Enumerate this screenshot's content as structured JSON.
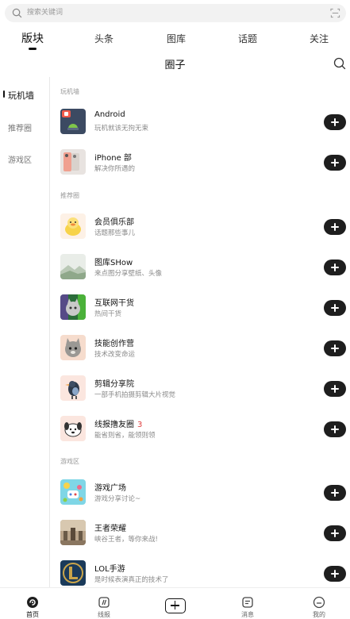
{
  "search": {
    "placeholder": "搜索关键词"
  },
  "tabs": [
    {
      "label": "版块",
      "active": true
    },
    {
      "label": "头条"
    },
    {
      "label": "图库"
    },
    {
      "label": "话题"
    },
    {
      "label": "关注"
    }
  ],
  "header": {
    "title": "圈子"
  },
  "sidebar": {
    "items": [
      {
        "label": "玩机墙",
        "active": true
      },
      {
        "label": "推荐圈"
      },
      {
        "label": "游戏区"
      }
    ]
  },
  "sections": [
    {
      "title": "玩机墙",
      "items": [
        {
          "name": "Android",
          "desc": "玩机就该无拘无束",
          "thumb": "android"
        },
        {
          "name": "iPhone 部",
          "desc": "解决你所遇的",
          "thumb": "iphone"
        }
      ]
    },
    {
      "title": "推荐圈",
      "items": [
        {
          "name": "会员俱乐部",
          "desc": "话题那些事儿",
          "thumb": "duck"
        },
        {
          "name": "图库SHow",
          "desc": "来点图分享壁纸、头像",
          "thumb": "landscape"
        },
        {
          "name": "互联网干货",
          "desc": "热间干货",
          "thumb": "cat-green"
        },
        {
          "name": "技能创作营",
          "desc": "技术改变命运",
          "thumb": "cat-grey"
        },
        {
          "name": "剪辑分享院",
          "desc": "一部手机拍摄剪辑大片视觉",
          "thumb": "bird"
        },
        {
          "name": "线报撸友圈",
          "desc": "能省则省，能领则领",
          "thumb": "dog",
          "badge": "3"
        }
      ]
    },
    {
      "title": "游戏区",
      "items": [
        {
          "name": "游戏广场",
          "desc": "游戏分享讨论~",
          "thumb": "game"
        },
        {
          "name": "王者荣耀",
          "desc": "峡谷王者，等你来战!",
          "thumb": "hok"
        },
        {
          "name": "LOL手游",
          "desc": "是时候表演真正的技术了",
          "thumb": "lol"
        }
      ]
    }
  ],
  "bottom_nav": [
    {
      "label": "首页",
      "icon": "home-icon",
      "active": true
    },
    {
      "label": "线报",
      "icon": "deals-icon"
    },
    {
      "label": "",
      "icon": "plus-icon"
    },
    {
      "label": "消息",
      "icon": "message-icon"
    },
    {
      "label": "我的",
      "icon": "profile-icon"
    }
  ]
}
